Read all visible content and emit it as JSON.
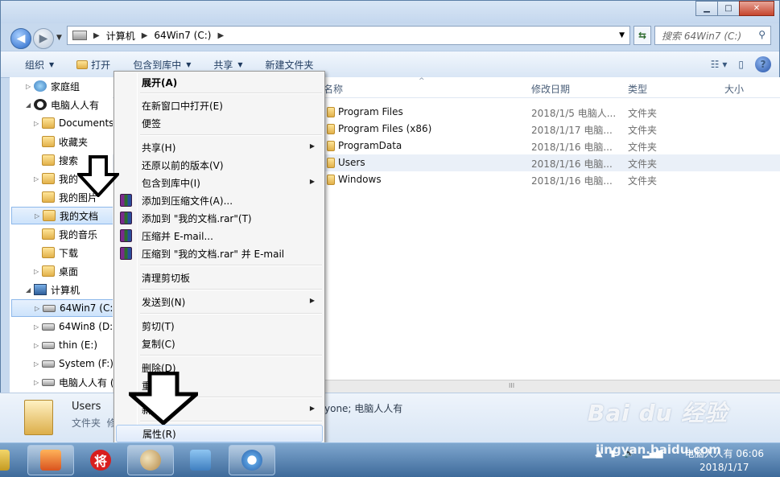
{
  "address": {
    "segments": [
      "计算机",
      "64Win7  (C:)"
    ]
  },
  "search": {
    "placeholder": "搜索 64Win7  (C:)"
  },
  "toolbar": {
    "organize": "组织",
    "open": "打开",
    "include_library": "包含到库中",
    "share": "共享",
    "new_folder": "新建文件夹"
  },
  "nav": {
    "items": [
      {
        "label": "家庭组"
      },
      {
        "label": "电脑人人有"
      },
      {
        "label": "Documents"
      },
      {
        "label": "收藏夹"
      },
      {
        "label": "搜索"
      },
      {
        "label": "我的"
      },
      {
        "label": "我的图片"
      },
      {
        "label": "我的文档"
      },
      {
        "label": "我的音乐"
      },
      {
        "label": "下载"
      },
      {
        "label": "桌面"
      },
      {
        "label": "计算机"
      },
      {
        "label": "64Win7  (C:"
      },
      {
        "label": "64Win8  (D:"
      },
      {
        "label": "thin (E:)"
      },
      {
        "label": "System (F:)"
      },
      {
        "label": "电脑人人有 ("
      }
    ]
  },
  "columns": {
    "name": "名称",
    "modified": "修改日期",
    "type": "类型",
    "size": "大小"
  },
  "files": [
    {
      "name": "Program Files",
      "date": "2018/1/5 电脑人...",
      "type": "文件夹"
    },
    {
      "name": "Program Files (x86)",
      "date": "2018/1/17 电脑...",
      "type": "文件夹"
    },
    {
      "name": "ProgramData",
      "date": "2018/1/16 电脑...",
      "type": "文件夹"
    },
    {
      "name": "Users",
      "date": "2018/1/16 电脑...",
      "type": "文件夹"
    },
    {
      "name": "Windows",
      "date": "2018/1/16 电脑...",
      "type": "文件夹"
    }
  ],
  "menu": {
    "expand": "展开(A)",
    "open_new_window": "在新窗口中打开(E)",
    "sticky": "便签",
    "share": "共享(H)",
    "restore": "还原以前的版本(V)",
    "include": "包含到库中(I)",
    "add_archive": "添加到压缩文件(A)...",
    "add_rar": "添加到 \"我的文档.rar\"(T)",
    "compress_email": "压缩并 E-mail...",
    "compress_rar_email": "压缩到 \"我的文档.rar\" 并 E-mail",
    "clear_clipboard": "清理剪切板",
    "send_to": "发送到(N)",
    "cut": "剪切(T)",
    "copy": "复制(C)",
    "delete": "删除(D)",
    "rename": "重",
    "new": "新",
    "properties": "属性(R)"
  },
  "details": {
    "name": "Users",
    "type": "文件夹",
    "type_suffix": "修",
    "share": "yone; 电脑人人有"
  },
  "taskbar": {
    "time": "06:06",
    "user": "电脑人人有",
    "date": "2018/1/17"
  },
  "watermark": {
    "brand": "Bai du 经验",
    "url": "jingyan.baidu.com"
  }
}
